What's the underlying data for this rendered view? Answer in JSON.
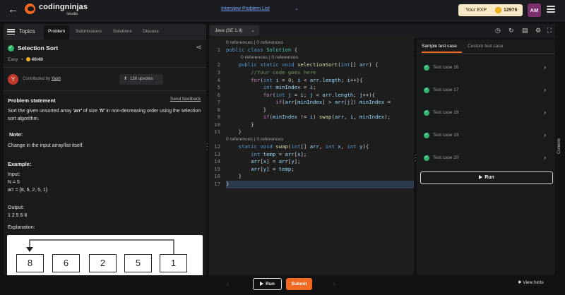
{
  "header": {
    "logo_text": "codingninjas",
    "logo_sub": "/studio",
    "problem_list": "Interview Problem List",
    "exp_label": "Your EXP",
    "exp_value": "12976",
    "avatar": "AM",
    "accent": "#f26a21"
  },
  "left_tabs": {
    "topics": "Topics",
    "tabs": [
      "Problem",
      "Submissions",
      "Solutions",
      "Discuss"
    ]
  },
  "problem": {
    "title": "Selection Sort",
    "difficulty": "Easy",
    "score": "40/40",
    "contributed_prefix": "Contributed by",
    "contributor": "Yash",
    "contributor_initial": "Y",
    "upvotes": "136 upvotes",
    "statement_heading": "Problem statement",
    "send_feedback": "Send feedback",
    "statement_pre": "Sort the given unsorted array ",
    "statement_arr": "'arr'",
    "statement_mid": " of size ",
    "statement_n": "'N'",
    "statement_post": " in non-decreasing order using the selection sort algorithm.",
    "note_heading": "Note:",
    "note_text": "Change in the input array/list itself.",
    "example_heading": "Example:",
    "input_label": "Input:",
    "input_n": "N = 5",
    "input_arr": "arr = {8, 6, 2, 5, 1}",
    "output_label": "Output:",
    "output_value": "1 2 5 6 8",
    "explanation_label": "Explanation:",
    "diagram_values": [
      "8",
      "6",
      "2",
      "5",
      "1"
    ]
  },
  "editor": {
    "language": "Java (SE 1.8)",
    "refs_label": "0 references | 0 references",
    "line_numbers": [
      "1",
      "2",
      "3",
      "4",
      "5",
      "6",
      "7",
      "8",
      "9",
      "10",
      "11",
      "12",
      "13",
      "14",
      "15",
      "16",
      "17"
    ]
  },
  "tests": {
    "tabs": [
      "Sample test case",
      "Custom test case"
    ],
    "cases": [
      "Test case 16",
      "Test case 17",
      "Test case 18",
      "Test case 19",
      "Test case 20"
    ],
    "run": "Run",
    "console": "Console"
  },
  "footer": {
    "run": "Run",
    "submit": "Submit",
    "hints": "View hints"
  }
}
